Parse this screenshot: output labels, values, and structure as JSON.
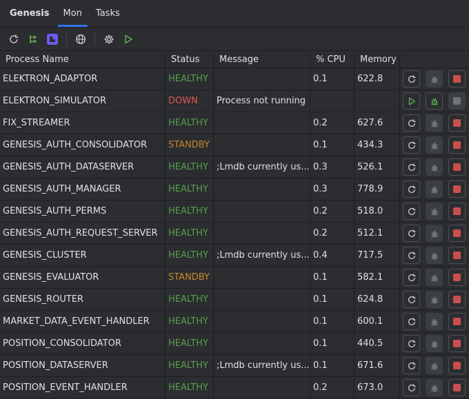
{
  "tabs": [
    {
      "label": "Genesis"
    },
    {
      "label": "Mon"
    },
    {
      "label": "Tasks"
    }
  ],
  "toolbar": {
    "icons": [
      "refresh-icon",
      "deploy-icon",
      "build-icon",
      "globe-icon",
      "gear-icon",
      "run-icon"
    ]
  },
  "table": {
    "headers": {
      "name": "Process Name",
      "status": "Status",
      "message": "Message",
      "cpu": "% CPU",
      "memory": "Memory"
    },
    "rows": [
      {
        "name": "ELEKTRON_ADAPTOR",
        "status": "HEALTHY",
        "message": "",
        "cpu": "0.1",
        "memory": "622.8",
        "running": true
      },
      {
        "name": "ELEKTRON_SIMULATOR",
        "status": "DOWN",
        "message": "Process not running",
        "cpu": "",
        "memory": "",
        "running": false
      },
      {
        "name": "FIX_STREAMER",
        "status": "HEALTHY",
        "message": "",
        "cpu": "0.2",
        "memory": "627.6",
        "running": true
      },
      {
        "name": "GENESIS_AUTH_CONSOLIDATOR",
        "status": "STANDBY",
        "message": "",
        "cpu": "0.1",
        "memory": "434.3",
        "running": true
      },
      {
        "name": "GENESIS_AUTH_DATASERVER",
        "status": "HEALTHY",
        "message": ";Lmdb currently us...",
        "cpu": "0.3",
        "memory": "526.1",
        "running": true
      },
      {
        "name": "GENESIS_AUTH_MANAGER",
        "status": "HEALTHY",
        "message": "",
        "cpu": "0.3",
        "memory": "778.9",
        "running": true
      },
      {
        "name": "GENESIS_AUTH_PERMS",
        "status": "HEALTHY",
        "message": "",
        "cpu": "0.2",
        "memory": "518.0",
        "running": true
      },
      {
        "name": "GENESIS_AUTH_REQUEST_SERVER",
        "status": "HEALTHY",
        "message": "",
        "cpu": "0.2",
        "memory": "512.1",
        "running": true
      },
      {
        "name": "GENESIS_CLUSTER",
        "status": "HEALTHY",
        "message": ";Lmdb currently us...",
        "cpu": "0.4",
        "memory": "717.5",
        "running": true
      },
      {
        "name": "GENESIS_EVALUATOR",
        "status": "STANDBY",
        "message": "",
        "cpu": "0.1",
        "memory": "582.1",
        "running": true
      },
      {
        "name": "GENESIS_ROUTER",
        "status": "HEALTHY",
        "message": "",
        "cpu": "0.1",
        "memory": "624.8",
        "running": true
      },
      {
        "name": "MARKET_DATA_EVENT_HANDLER",
        "status": "HEALTHY",
        "message": "",
        "cpu": "0.1",
        "memory": "600.1",
        "running": true
      },
      {
        "name": "POSITION_CONSOLIDATOR",
        "status": "HEALTHY",
        "message": "",
        "cpu": "0.1",
        "memory": "440.5",
        "running": true
      },
      {
        "name": "POSITION_DATASERVER",
        "status": "HEALTHY",
        "message": ";Lmdb currently us...",
        "cpu": "0.1",
        "memory": "671.6",
        "running": true
      },
      {
        "name": "POSITION_EVENT_HANDLER",
        "status": "HEALTHY",
        "message": "",
        "cpu": "0.2",
        "memory": "673.0",
        "running": true
      }
    ]
  },
  "colors": {
    "healthy": "#5a9e4d",
    "down": "#e05656",
    "standby": "#c7872a",
    "accent": "#3574f0"
  }
}
